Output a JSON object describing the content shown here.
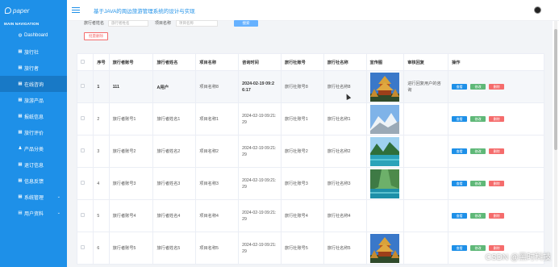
{
  "logo": {
    "text": "paper"
  },
  "sidebar": {
    "heading": "MAIN NAVIGATION",
    "items": [
      {
        "label": "Dashboard",
        "icon": "dashboard-icon",
        "glyph": "◍"
      },
      {
        "label": "旅行社",
        "icon": "grid-icon",
        "glyph": "▦"
      },
      {
        "label": "旅行者",
        "icon": "grid-icon",
        "glyph": "▦"
      },
      {
        "label": "在线咨询",
        "icon": "grid-icon",
        "glyph": "▦",
        "active": true
      },
      {
        "label": "旅游产品",
        "icon": "grid-icon",
        "glyph": "▦"
      },
      {
        "label": "报纸信息",
        "icon": "grid-icon",
        "glyph": "▦"
      },
      {
        "label": "旅行评价",
        "icon": "grid-icon",
        "glyph": "▦"
      },
      {
        "label": "产品分类",
        "icon": "user-icon",
        "glyph": "♟"
      },
      {
        "label": "退订信息",
        "icon": "grid-icon",
        "glyph": "▦"
      },
      {
        "label": "信息反馈",
        "icon": "grid-icon",
        "glyph": "▦"
      },
      {
        "label": "系统管理",
        "icon": "grid-icon",
        "glyph": "▦",
        "caret": "⌄"
      },
      {
        "label": "用户资料",
        "icon": "list-icon",
        "glyph": "▤",
        "caret": "⌄"
      }
    ]
  },
  "header": {
    "title": "基于JAVA的周边旅游管理系统的设计与实现"
  },
  "filter": {
    "label1": "旅行者姓名",
    "placeholder1": "旅行者姓名",
    "label2": "项目名称",
    "placeholder2": "项目名称",
    "search": "搜索",
    "batch_delete": "批量删除"
  },
  "table": {
    "headers": [
      "",
      "序号",
      "旅行者账号",
      "旅行者姓名",
      "项目名称",
      "咨询时间",
      "旅行社账号",
      "旅行社名称",
      "宣传图",
      "审核回复",
      "操作"
    ],
    "rows": [
      {
        "no": "1",
        "account": "111",
        "name": "A用户",
        "project": "项目名称8",
        "time": "2024-02-19 09:2 6:17",
        "agency_acc": "旅行社账号8",
        "agency_name": "旅行社名称8",
        "image": "pagoda",
        "reply": "进行回复用户的咨询"
      },
      {
        "no": "2",
        "account": "旅行者账号1",
        "name": "旅行者姓名1",
        "project": "项目名称1",
        "time": "2024-02-19 09:21: 29",
        "agency_acc": "旅行社账号1",
        "agency_name": "旅行社名称1",
        "image": "mountain",
        "reply": ""
      },
      {
        "no": "3",
        "account": "旅行者账号2",
        "name": "旅行者姓名2",
        "project": "项目名称2",
        "time": "2024-02-19 09:21: 29",
        "agency_acc": "旅行社账号2",
        "agency_name": "旅行社名称2",
        "image": "lake",
        "reply": ""
      },
      {
        "no": "4",
        "account": "旅行者账号3",
        "name": "旅行者姓名3",
        "project": "项目名称3",
        "time": "2024-02-19 09:21: 29",
        "agency_acc": "旅行社账号3",
        "agency_name": "旅行社名称3",
        "image": "valley",
        "reply": ""
      },
      {
        "no": "5",
        "account": "旅行者账号4",
        "name": "旅行者姓名4",
        "project": "项目名称4",
        "time": "2024-02-19 09:21: 29",
        "agency_acc": "旅行社账号4",
        "agency_name": "旅行社名称4",
        "image": "none",
        "reply": ""
      },
      {
        "no": "6",
        "account": "旅行者账号5",
        "name": "旅行者姓名5",
        "project": "项目名称5",
        "time": "2024-02-19 09:21: 29",
        "agency_acc": "旅行社账号5",
        "agency_name": "旅行社名称5",
        "image": "pagoda",
        "reply": ""
      }
    ],
    "actions": {
      "view": "查看",
      "edit": "修改",
      "delete": "删除"
    }
  },
  "watermark": "CSDN @黑时科技",
  "colors": {
    "primary": "#1e90e8",
    "danger": "#f56c6c",
    "success": "#5fb878"
  }
}
